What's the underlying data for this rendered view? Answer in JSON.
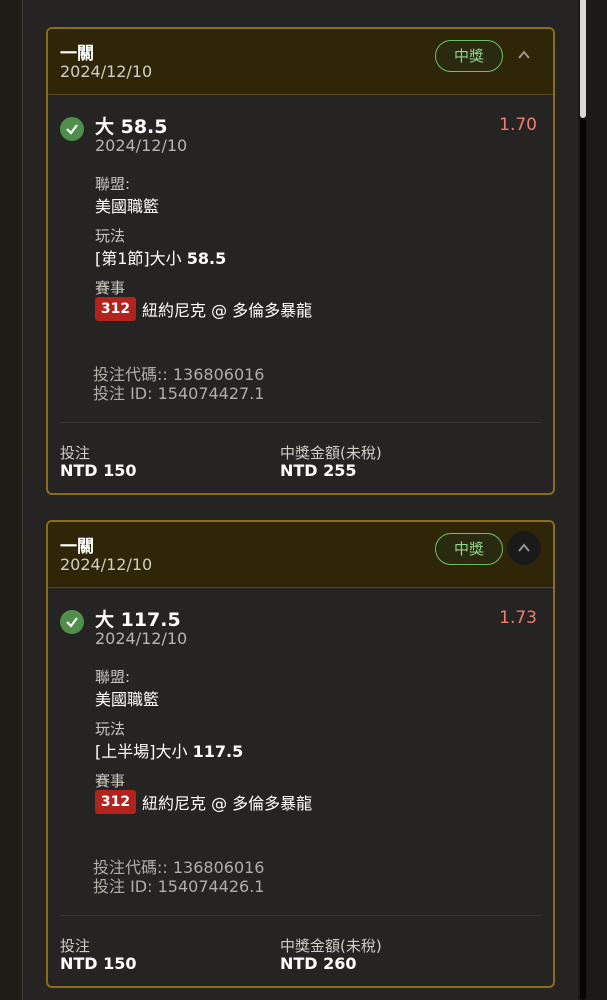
{
  "cards": [
    {
      "title": "一關",
      "date": "2024/12/10",
      "status_badge": "中獎",
      "selection": {
        "name": "大 58.5",
        "date": "2024/12/10",
        "odds": "1.70",
        "league_label": "聯盟:",
        "league_value": "美國職籃",
        "play_label": "玩法",
        "play_value_prefix": "[第1節]大小",
        "play_value_number": "58.5",
        "event_label": "賽事",
        "event_number": "312",
        "event_name": "紐約尼克 @ 多倫多暴龍",
        "bet_code": "投注代碼:: 136806016",
        "bet_id": "投注 ID: 154074427.1"
      },
      "footer": {
        "stake_label": "投注",
        "stake_value": "NTD 150",
        "payout_label": "中獎金額(未稅)",
        "payout_value": "NTD 255"
      }
    },
    {
      "title": "一關",
      "date": "2024/12/10",
      "status_badge": "中獎",
      "selection": {
        "name": "大 117.5",
        "date": "2024/12/10",
        "odds": "1.73",
        "league_label": "聯盟:",
        "league_value": "美國職籃",
        "play_label": "玩法",
        "play_value_prefix": "[上半場]大小",
        "play_value_number": "117.5",
        "event_label": "賽事",
        "event_number": "312",
        "event_name": "紐約尼克 @ 多倫多暴龍",
        "bet_code": "投注代碼:: 136806016",
        "bet_id": "投注 ID: 154074426.1"
      },
      "footer": {
        "stake_label": "投注",
        "stake_value": "NTD 150",
        "payout_label": "中獎金額(未稅)",
        "payout_value": "NTD 260"
      }
    }
  ],
  "icons": {
    "check": "check-circle-icon",
    "collapse": "chevron-up-icon"
  },
  "colors": {
    "accent_border": "#8a6d16",
    "win_green": "#8fd58a",
    "odds_red": "#f07d6e",
    "event_red": "#b3231e"
  }
}
